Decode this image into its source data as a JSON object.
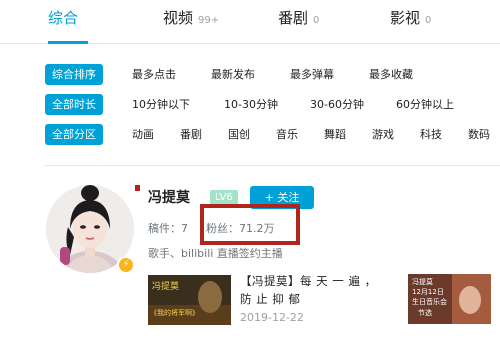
{
  "tabs": [
    {
      "label": "综合",
      "count": ""
    },
    {
      "label": "视频",
      "count": "99+"
    },
    {
      "label": "番剧",
      "count": "0"
    },
    {
      "label": "影视",
      "count": "0"
    }
  ],
  "filters": {
    "sort": {
      "badge": "综合排序",
      "options": [
        "最多点击",
        "最新发布",
        "最多弹幕",
        "最多收藏"
      ]
    },
    "duration": {
      "badge": "全部时长",
      "options": [
        "10分钟以下",
        "10-30分钟",
        "30-60分钟",
        "60分钟以上"
      ]
    },
    "zone": {
      "badge": "全部分区",
      "options": [
        "动画",
        "番剧",
        "国创",
        "音乐",
        "舞蹈",
        "游戏",
        "科技",
        "数码"
      ]
    }
  },
  "user": {
    "name": "冯提莫",
    "level": "LV6",
    "follow_label": "+ 关注",
    "uploads": "稿件：7",
    "fans": "粉丝：71.2万",
    "description": "歌手、bilibili 直播签约主播"
  },
  "videos": [
    {
      "thumb_text_top": "冯提莫",
      "thumb_text_bottom": "《我的将军啊》"
    },
    {
      "title": "【冯提莫】每 天 一 遍 ， 防 止 抑 郁",
      "date": "2019-12-22"
    },
    {
      "thumb_text_top": "冯提莫",
      "thumb_text_mid": "12月12日",
      "thumb_text_mid2": "生日音乐会",
      "thumb_text_bottom": "节选"
    }
  ],
  "colors": {
    "accent": "#00a1d6",
    "highlight": "#b0251e",
    "gold": "#fbb31c"
  }
}
